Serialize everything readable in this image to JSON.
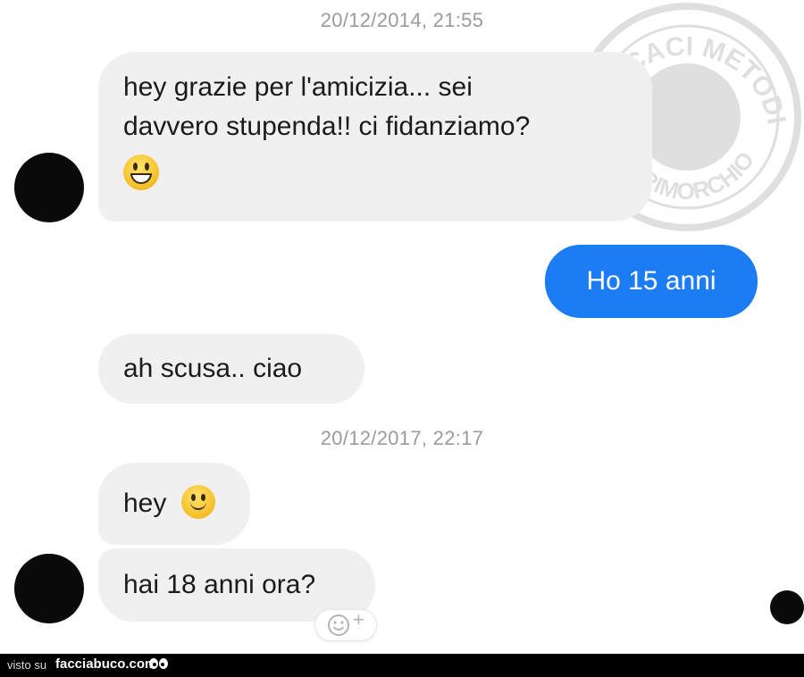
{
  "conversation": {
    "timestamp_1": "20/12/2014, 21:55",
    "msg_1_line_1": "hey grazie per l'amicizia... sei",
    "msg_1_line_2": "davvero stupenda!! ci fidanziamo?",
    "msg_1_emoji": "grinning-face",
    "msg_2": "Ho 15 anni",
    "msg_3": "ah scusa.. ciao",
    "timestamp_2": "20/12/2017, 22:17",
    "msg_4": "hey",
    "msg_4_emoji": "slightly-smiling-face",
    "msg_5": "hai 18 anni ora?"
  },
  "reaction_button": {
    "plus": "+"
  },
  "watermark": {
    "text_top": "EFFICACI METODI",
    "text_bottom": "DI RIMORCHIO"
  },
  "footer": {
    "prefix": "visto su",
    "site": "facciabuco.com"
  },
  "colors": {
    "incoming_bubble": "#f0f0f1",
    "outgoing_bubble": "#1b7cf3",
    "timestamp": "#9a9a9f"
  }
}
